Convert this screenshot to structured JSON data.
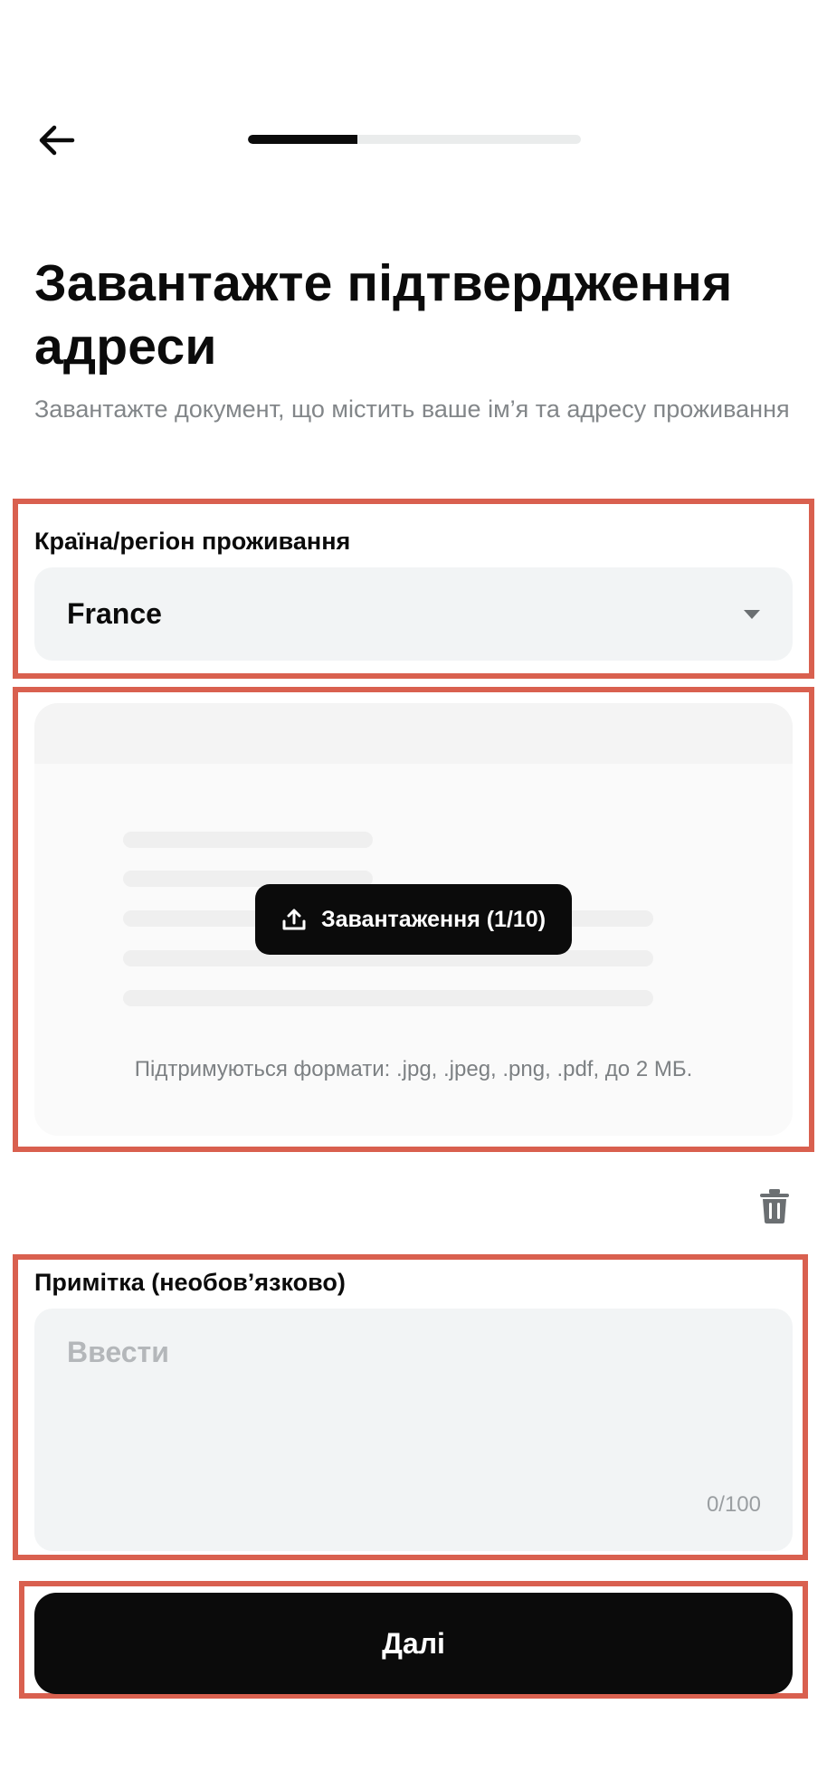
{
  "header": {
    "back_icon": "arrow-left-icon",
    "progress_fraction": 0.33
  },
  "page": {
    "title": "Завантажте підтвердження адреси",
    "subtitle": "Завантажте документ, що містить ваше ім’я та адресу проживання"
  },
  "country": {
    "label": "Країна/регіон проживання",
    "value": "France",
    "icon": "caret-down-icon"
  },
  "upload": {
    "button_label": "Завантаження (1/10)",
    "button_icon": "upload-icon",
    "formats_text": "Підтримуються формати: .jpg, .jpeg, .png, .pdf, до 2 МБ.",
    "delete_icon": "trash-icon"
  },
  "note": {
    "label": "Примітка (необов’язково)",
    "placeholder": "Ввести",
    "counter": "0/100"
  },
  "footer": {
    "next_label": "Далі"
  },
  "colors": {
    "primary": "#0b0b0b",
    "field_bg": "#f2f4f5",
    "highlight": "#d9604f",
    "muted_text": "#828689"
  }
}
